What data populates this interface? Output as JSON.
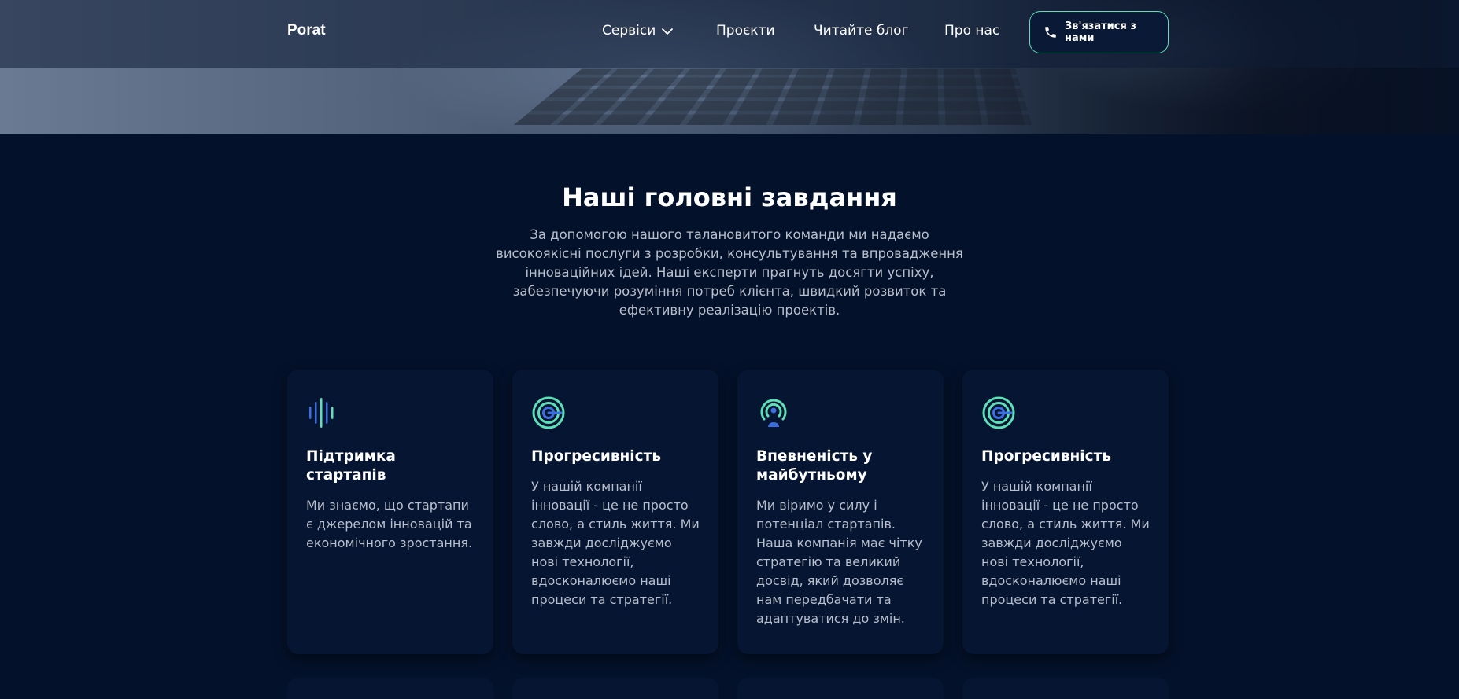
{
  "nav": {
    "logo": "Porat",
    "services": "Сервіси",
    "projects": "Проєкти",
    "blog": "Читайте блог",
    "about": "Про нас",
    "contact": "Зв'язатися з нами"
  },
  "section": {
    "title": "Наші головні завдання",
    "intro": "За допомогою нашого таланови­того команди ми надаємо високоякісні послуги з розробки, консультування та впровадження інноваційних ідей. Наші експерти прагнуть досягти успіху, забезпечуючи розуміння потреб клієнта, швидкий розвиток та ефективну реалізацію проектів."
  },
  "cards": [
    {
      "icon": "soundwave-icon",
      "title": "Підтримка стартапів",
      "text": "Ми знаємо, що стартапи є джерелом інновацій та економічного зростання."
    },
    {
      "icon": "target-icon",
      "title": "Прогресивність",
      "text": "У нашій компанії інновації - це не просто слово, а стиль життя. Ми завжди досліджуємо нові технології, вдосконалюємо наші процеси та стратегії."
    },
    {
      "icon": "broadcast-person-icon",
      "title": "Впевненість у майбутньому",
      "text": "Ми віримо у силу і потенціал стартапів. Наша компанія має чітку стратегію та великий досвід, який дозволяє нам передбачати та адаптуватися до змін."
    },
    {
      "icon": "target-icon",
      "title": "Прогресивність",
      "text": "У нашій компанії інновації - це не просто слово, а стиль життя. Ми завжди досліджуємо нові технології, вдосконалюємо наші процеси та стратегії."
    }
  ],
  "colors": {
    "background": "#04112a",
    "card": "#061531",
    "accent_green": "#5ce0b8",
    "accent_blue": "#3b6fe0",
    "text_muted": "#b8bfcc"
  }
}
